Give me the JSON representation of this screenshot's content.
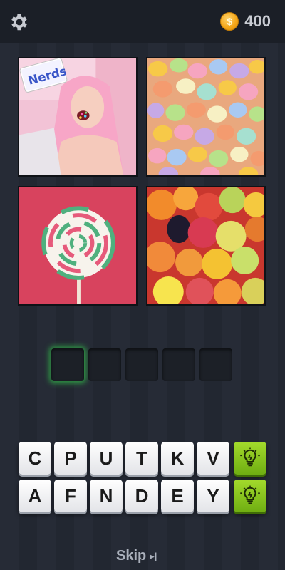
{
  "header": {
    "settings_icon": "gear-icon",
    "coin_icon_symbol": "$",
    "coin_count": "400"
  },
  "images": [
    {
      "subject": "woman eating Nerds candy",
      "package_text": "Nerds"
    },
    {
      "subject": "candy conversation hearts"
    },
    {
      "subject": "swirl lollipop"
    },
    {
      "subject": "fruit drops"
    }
  ],
  "answer": {
    "slot_count": 5,
    "filled": [
      "",
      "",
      "",
      "",
      ""
    ]
  },
  "keyboard": {
    "row1": [
      "C",
      "P",
      "U",
      "T",
      "K",
      "V"
    ],
    "row2": [
      "A",
      "F",
      "N",
      "D",
      "E",
      "Y"
    ],
    "hint_icon": "lightbulb-icon"
  },
  "footer": {
    "skip_label": "Skip",
    "skip_icon_symbol": "▸|"
  },
  "colors": {
    "accent_green": "#7fc21c",
    "coin_gold": "#f4a516"
  }
}
